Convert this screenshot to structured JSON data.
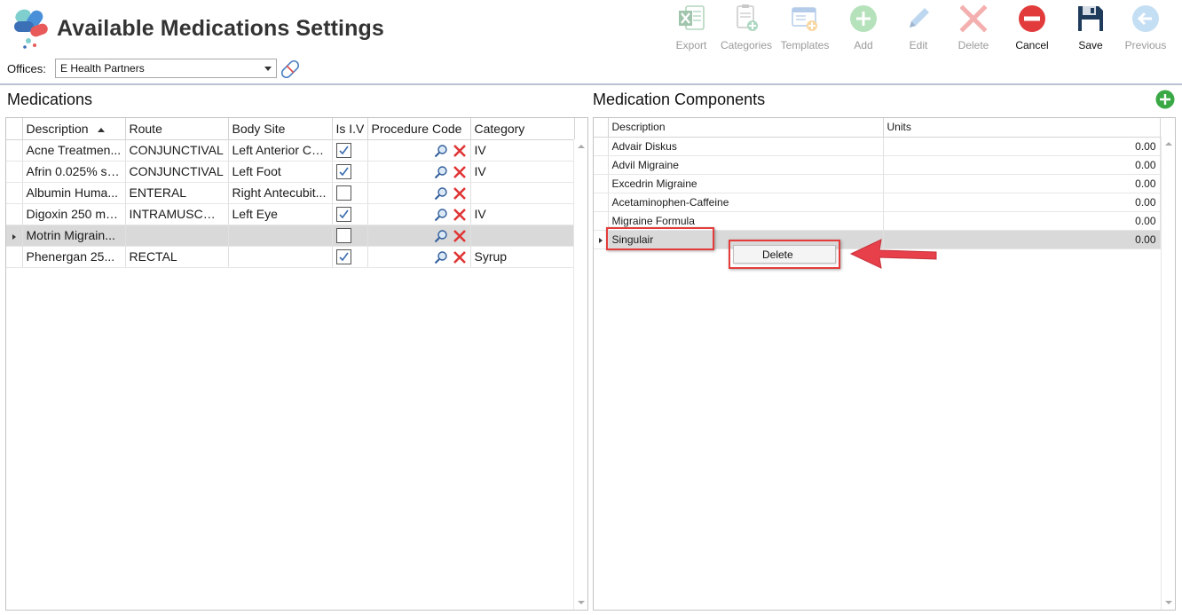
{
  "app": {
    "title": "Available Medications Settings"
  },
  "offices": {
    "label": "Offices:",
    "selected": "E Health Partners"
  },
  "toolbar": [
    {
      "key": "export",
      "label": "Export",
      "icon": "excel-export-icon",
      "enabled": false
    },
    {
      "key": "categories",
      "label": "Categories",
      "icon": "categories-icon",
      "enabled": false
    },
    {
      "key": "templates",
      "label": "Templates",
      "icon": "templates-icon",
      "enabled": false
    },
    {
      "key": "add",
      "label": "Add",
      "icon": "add-icon",
      "enabled": false
    },
    {
      "key": "edit",
      "label": "Edit",
      "icon": "edit-icon",
      "enabled": false
    },
    {
      "key": "delete",
      "label": "Delete",
      "icon": "delete-icon",
      "enabled": false
    },
    {
      "key": "cancel",
      "label": "Cancel",
      "icon": "cancel-icon",
      "enabled": true
    },
    {
      "key": "save",
      "label": "Save",
      "icon": "save-icon",
      "enabled": true
    },
    {
      "key": "previous",
      "label": "Previous",
      "icon": "previous-icon",
      "enabled": false
    }
  ],
  "medications": {
    "title": "Medications",
    "columns": [
      "Description",
      "Route",
      "Body Site",
      "Is I.V",
      "Procedure Code",
      "Category"
    ],
    "rows": [
      {
        "description": "Acne Treatmen...",
        "route": "CONJUNCTIVAL",
        "body_site": "Left Anterior Ch...",
        "is_iv": true,
        "category": "IV",
        "selected": false
      },
      {
        "description": "Afrin 0.025% so...",
        "route": "CONJUNCTIVAL",
        "body_site": "Left Foot",
        "is_iv": true,
        "category": "IV",
        "selected": false
      },
      {
        "description": "Albumin Huma...",
        "route": "ENTERAL",
        "body_site": "Right Antecubit...",
        "is_iv": false,
        "category": "",
        "selected": false
      },
      {
        "description": "Digoxin 250 mc...",
        "route": "INTRAMUSCUL...",
        "body_site": "Left Eye",
        "is_iv": true,
        "category": "IV",
        "selected": false
      },
      {
        "description": "Motrin Migrain...",
        "route": "",
        "body_site": "",
        "is_iv": false,
        "category": "",
        "selected": true
      },
      {
        "description": "Phenergan 25...",
        "route": "RECTAL",
        "body_site": "",
        "is_iv": true,
        "category": "Syrup",
        "selected": false
      }
    ]
  },
  "components": {
    "title": "Medication Components",
    "columns": [
      "Description",
      "Units"
    ],
    "rows": [
      {
        "description": "Advair Diskus",
        "units": "0.00",
        "selected": false
      },
      {
        "description": "Advil Migraine",
        "units": "0.00",
        "selected": false
      },
      {
        "description": "Excedrin Migraine",
        "units": "0.00",
        "selected": false
      },
      {
        "description": "Acetaminophen-Caffeine",
        "units": "0.00",
        "selected": false
      },
      {
        "description": "Migraine Formula",
        "units": "0.00",
        "selected": false
      },
      {
        "description": "Singulair",
        "units": "0.00",
        "selected": true
      }
    ]
  },
  "context_menu": {
    "items": [
      "Delete"
    ]
  },
  "colors": {
    "accent_red": "#e43b3b",
    "selection": "#d9d9d9",
    "add_green": "#3aa845",
    "rule": "#b7c3d3"
  }
}
